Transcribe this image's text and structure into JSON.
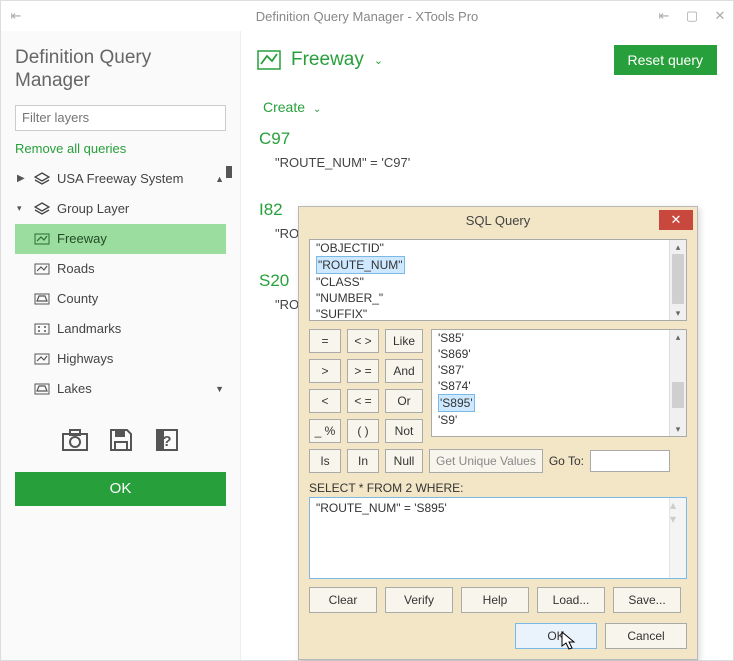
{
  "window": {
    "title": "Definition Query Manager - XTools Pro"
  },
  "sidebar": {
    "heading": "Definition Query Manager",
    "filter_placeholder": "Filter layers",
    "remove_all": "Remove all queries",
    "items": [
      {
        "label": "USA Freeway System"
      },
      {
        "label": "Group Layer"
      },
      {
        "label": "Freeway"
      },
      {
        "label": "Roads"
      },
      {
        "label": "County"
      },
      {
        "label": "Landmarks"
      },
      {
        "label": "Highways"
      },
      {
        "label": "Lakes"
      }
    ],
    "ok_label": "OK"
  },
  "main": {
    "layer": "Freeway",
    "reset_label": "Reset query",
    "create_label": "Create",
    "queries": [
      {
        "name": "C97",
        "expr": "\"ROUTE_NUM\" = 'C97'"
      },
      {
        "name": "I82",
        "expr": "\"RO"
      },
      {
        "name": "S20",
        "expr": "\"RO"
      }
    ]
  },
  "dialog": {
    "title": "SQL Query",
    "fields": [
      "\"OBJECTID\"",
      "\"ROUTE_NUM\"",
      "\"CLASS\"",
      "\"NUMBER_\"",
      "\"SUFFIX\""
    ],
    "field_selected_index": 1,
    "ops": {
      "r1": [
        "=",
        "< >",
        "Like"
      ],
      "r2": [
        ">",
        "> =",
        "And"
      ],
      "r3": [
        "<",
        "< =",
        "Or"
      ],
      "r4": [
        "_ %",
        "( )",
        "Not"
      ],
      "r5": [
        "Is",
        "In",
        "Null"
      ]
    },
    "values": [
      "'S85'",
      "'S869'",
      "'S87'",
      "'S874'",
      "'S895'",
      "'S9'"
    ],
    "value_selected_index": 4,
    "get_unique": "Get Unique Values",
    "goto_label": "Go To:",
    "where_label": "SELECT * FROM 2 WHERE:",
    "where_text": "\"ROUTE_NUM\" = 'S895'",
    "buttons": {
      "clear": "Clear",
      "verify": "Verify",
      "help": "Help",
      "load": "Load...",
      "save": "Save...",
      "ok": "OK",
      "cancel": "Cancel"
    }
  }
}
